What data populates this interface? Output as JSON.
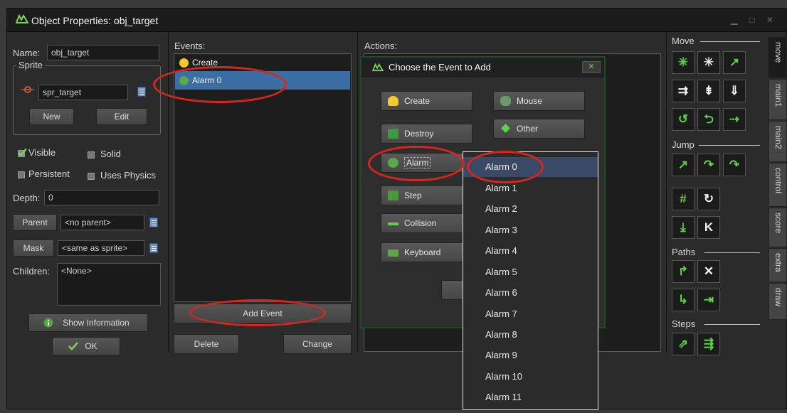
{
  "window": {
    "title": "Object Properties: obj_target",
    "controls": [
      "minimize",
      "maximize",
      "close"
    ]
  },
  "object": {
    "name_label": "Name:",
    "name_value": "obj_target",
    "sprite_group": "Sprite",
    "sprite_value": "spr_target",
    "new_label": "New",
    "edit_label": "Edit",
    "visible_label": "Visible",
    "visible_checked": true,
    "solid_label": "Solid",
    "persistent_label": "Persistent",
    "uses_physics_label": "Uses Physics",
    "depth_label": "Depth:",
    "depth_value": "0",
    "parent_label": "Parent",
    "parent_value": "<no parent>",
    "mask_label": "Mask",
    "mask_value": "<same as sprite>",
    "children_label": "Children:",
    "children_value": "<None>",
    "show_info_label": "Show Information",
    "ok_label": "OK"
  },
  "events": {
    "header": "Events:",
    "items": [
      "Create",
      "Alarm 0"
    ],
    "selected": "Alarm 0",
    "add_label": "Add Event",
    "delete_label": "Delete",
    "change_label": "Change"
  },
  "actions": {
    "header": "Actions:"
  },
  "dialog": {
    "title": "Choose the Event to Add",
    "close_label": "✕",
    "buttons": {
      "create": "Create",
      "mouse": "Mouse",
      "destroy": "Destroy",
      "other": "Other",
      "alarm": "Alarm",
      "step": "Step",
      "collision": "Collision",
      "keyboard": "Keyboard"
    }
  },
  "alarm_menu": {
    "items": [
      "Alarm 0",
      "Alarm 1",
      "Alarm 2",
      "Alarm 3",
      "Alarm 4",
      "Alarm 5",
      "Alarm 6",
      "Alarm 7",
      "Alarm 8",
      "Alarm 9",
      "Alarm 10",
      "Alarm 11"
    ],
    "selected": "Alarm 0"
  },
  "toolbox": {
    "sections": {
      "move": "Move",
      "jump": "Jump",
      "paths": "Paths",
      "steps": "Steps"
    },
    "tabs": [
      "move",
      "main1",
      "main2",
      "control",
      "score",
      "extra",
      "draw"
    ],
    "active_tab": "move"
  },
  "colors": {
    "highlight_ring": "#d7261c",
    "selection": "#3a6ea5",
    "tool_green": "#5fd14a"
  }
}
